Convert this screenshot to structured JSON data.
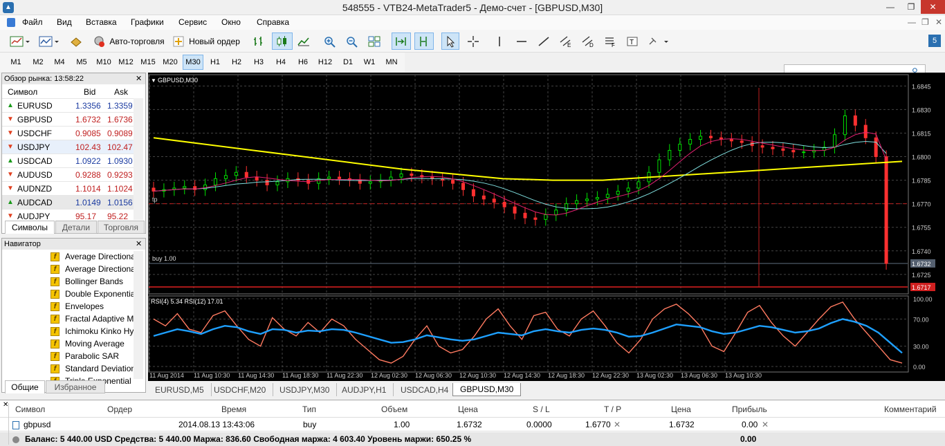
{
  "window": {
    "title": "548555 - VTB24-MetaTrader5 - Демо-счет - [GBPUSD,M30]",
    "min": "—",
    "max": "❐",
    "close": "✕"
  },
  "menu": [
    "Файл",
    "Вид",
    "Вставка",
    "Графики",
    "Сервис",
    "Окно",
    "Справка"
  ],
  "toolbar": {
    "auto_trading": "Авто-торговля",
    "new_order": "Новый ордер",
    "search_placeholder": "",
    "badge": "5"
  },
  "timeframes": [
    "M1",
    "M2",
    "M4",
    "M5",
    "M10",
    "M12",
    "M15",
    "M20",
    "M30",
    "H1",
    "H2",
    "H3",
    "H4",
    "H6",
    "H12",
    "D1",
    "W1",
    "MN"
  ],
  "active_timeframe": "M30",
  "market_watch": {
    "title": "Обзор рынка: 13:58:22",
    "col_symbol": "Символ",
    "col_bid": "Bid",
    "col_ask": "Ask",
    "rows": [
      {
        "symbol": "EURUSD",
        "bid": "1.3356",
        "ask": "1.3359",
        "dir": "up"
      },
      {
        "symbol": "GBPUSD",
        "bid": "1.6732",
        "ask": "1.6736",
        "dir": "down"
      },
      {
        "symbol": "USDCHF",
        "bid": "0.9085",
        "ask": "0.9089",
        "dir": "down"
      },
      {
        "symbol": "USDJPY",
        "bid": "102.43",
        "ask": "102.47",
        "dir": "down"
      },
      {
        "symbol": "USDCAD",
        "bid": "1.0922",
        "ask": "1.0930",
        "dir": "up"
      },
      {
        "symbol": "AUDUSD",
        "bid": "0.9288",
        "ask": "0.9293",
        "dir": "down"
      },
      {
        "symbol": "AUDNZD",
        "bid": "1.1014",
        "ask": "1.1024",
        "dir": "down"
      },
      {
        "symbol": "AUDCAD",
        "bid": "1.0149",
        "ask": "1.0156",
        "dir": "up"
      },
      {
        "symbol": "AUDJPY",
        "bid": "95.17",
        "ask": "95.22",
        "dir": "down"
      }
    ],
    "tabs": [
      "Символы",
      "Детали",
      "Торговля"
    ]
  },
  "navigator": {
    "title": "Навигатор",
    "items": [
      "Average Directional",
      "Average Directional",
      "Bollinger Bands",
      "Double Exponential",
      "Envelopes",
      "Fractal Adaptive M",
      "Ichimoku Kinko Hy",
      "Moving Average",
      "Parabolic SAR",
      "Standard Deviation",
      "Triple Exponential"
    ],
    "tabs": [
      "Общие",
      "Избранное"
    ]
  },
  "chart": {
    "symbol_label": "GBPUSD,M30",
    "tp_label": "tp",
    "buy_label": "buy 1.00",
    "price_ticks": [
      "1.6845",
      "1.6830",
      "1.6815",
      "1.6800",
      "1.6785",
      "1.6770",
      "1.6755",
      "1.6740",
      "1.6725"
    ],
    "current_price": "1.6732",
    "red_price": "1.6717",
    "rsi_label": "RSI(4) 5.34 RSI(12) 17.01",
    "rsi_ticks": [
      "100.00",
      "70.00",
      "30.00",
      "0.00"
    ],
    "time_ticks": [
      "11 Aug 2014",
      "11 Aug 10:30",
      "11 Aug 14:30",
      "11 Aug 18:30",
      "11 Aug 22:30",
      "12 Aug 02:30",
      "12 Aug 06:30",
      "12 Aug 10:30",
      "12 Aug 14:30",
      "12 Aug 18:30",
      "12 Aug 22:30",
      "13 Aug 02:30",
      "13 Aug 06:30",
      "13 Aug 10:30"
    ],
    "colors": {
      "bull": "#00e000",
      "bear": "#ff3030",
      "ma_slow": "#ffff00",
      "ma_mid": "#80e0e0",
      "ma_fast": "#e02070",
      "rsi_fast": "#ff7a60",
      "rsi_slow": "#1ea0ff"
    }
  },
  "chart_data": {
    "type": "line",
    "title": "GBPUSD,M30",
    "ylim": [
      1.6717,
      1.685
    ],
    "series": [
      {
        "name": "GBPUSD",
        "values": [
          1.6778,
          1.6779,
          1.678,
          1.6781,
          1.6779,
          1.6782,
          1.6786,
          1.6788,
          1.679,
          1.6787,
          1.6785,
          1.6782,
          1.6784,
          1.6786,
          1.6785,
          1.6783,
          1.6786,
          1.6787,
          1.6786,
          1.6785,
          1.6783,
          1.6784,
          1.6785,
          1.6787,
          1.6789,
          1.6788,
          1.6787,
          1.6786,
          1.6785,
          1.6783,
          1.6779,
          1.6775,
          1.6773,
          1.6771,
          1.6768,
          1.6764,
          1.6761,
          1.676,
          1.6763,
          1.6766,
          1.677,
          1.6772,
          1.6773,
          1.6774,
          1.6776,
          1.6778,
          1.678,
          1.6784,
          1.679,
          1.6798,
          1.6804,
          1.6808,
          1.6811,
          1.6813,
          1.6812,
          1.6811,
          1.681,
          1.6809,
          1.6807,
          1.6806,
          1.6805,
          1.6804,
          1.6803,
          1.6803,
          1.6804,
          1.6806,
          1.6814,
          1.6826,
          1.682,
          1.6812,
          1.68,
          1.6732
        ]
      },
      {
        "name": "RSI(4)",
        "values": [
          70,
          60,
          78,
          55,
          50,
          75,
          82,
          60,
          40,
          30,
          72,
          55,
          45,
          65,
          50,
          70,
          60,
          40,
          25,
          10,
          5,
          15,
          40,
          60,
          30,
          20,
          25,
          45,
          70,
          85,
          60,
          40,
          75,
          80,
          55,
          45,
          70,
          82,
          60,
          35,
          20,
          40,
          70,
          85,
          92,
          78,
          60,
          30,
          22,
          50,
          80,
          90,
          65,
          45,
          30,
          50,
          70,
          88,
          95,
          70,
          50,
          30,
          10,
          5
        ]
      },
      {
        "name": "RSI(12)",
        "values": [
          45,
          50,
          55,
          52,
          48,
          55,
          60,
          58,
          52,
          48,
          55,
          54,
          50,
          53,
          52,
          55,
          54,
          50,
          45,
          40,
          35,
          36,
          40,
          46,
          43,
          40,
          38,
          40,
          45,
          50,
          48,
          46,
          52,
          55,
          52,
          50,
          54,
          56,
          54,
          50,
          44,
          45,
          50,
          56,
          62,
          60,
          58,
          52,
          48,
          50,
          55,
          60,
          58,
          54,
          50,
          52,
          56,
          64,
          70,
          66,
          60,
          50,
          35,
          20
        ]
      }
    ],
    "y_ticks": [
      "1.6845",
      "1.6830",
      "1.6815",
      "1.6800",
      "1.6785",
      "1.6770",
      "1.6755",
      "1.6740",
      "1.6725"
    ]
  },
  "chart_tabs": [
    "EURUSD,M5",
    "USDCHF,M20",
    "USDJPY,M30",
    "AUDJPY,H1",
    "USDCAD,H4",
    "GBPUSD,M30"
  ],
  "active_chart_tab": "GBPUSD,M30",
  "terminal": {
    "headers": {
      "symbol": "Символ",
      "order": "Ордер",
      "time": "Время",
      "type": "Тип",
      "volume": "Объем",
      "price": "Цена",
      "sl": "S / L",
      "tp": "T / P",
      "cur_price": "Цена",
      "profit": "Прибыль",
      "comment": "Комментарий"
    },
    "row": {
      "symbol": "gbpusd",
      "order": "",
      "time": "2014.08.13 13:43:06",
      "type": "buy",
      "volume": "1.00",
      "price": "1.6732",
      "sl": "0.0000",
      "tp": "1.6770",
      "cur_price": "1.6732",
      "profit": "0.00"
    },
    "footer": {
      "summary": "Баланс: 5 440.00 USD  Средства: 5 440.00  Маржа: 836.60  Свободная маржа: 4 603.40  Уровень маржи: 650.25 %",
      "profit": "0.00"
    }
  }
}
